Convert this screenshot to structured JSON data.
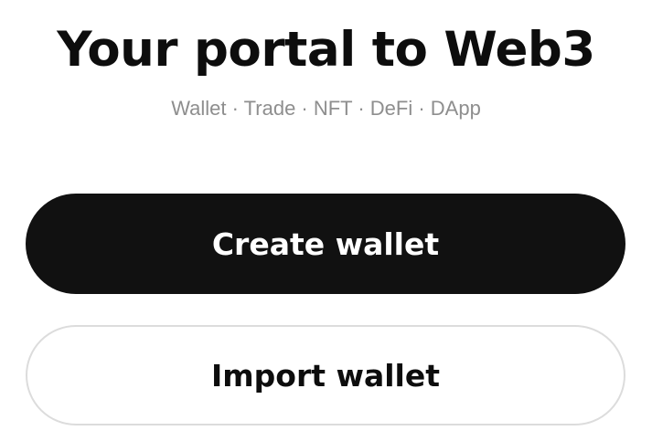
{
  "header": {
    "title": "Your portal to Web3",
    "tagline": "Wallet · Trade · NFT · DeFi · DApp"
  },
  "actions": {
    "create_label": "Create wallet",
    "import_label": "Import wallet"
  },
  "colors": {
    "primary_button": "#111111",
    "primary_text": "#ffffff",
    "secondary_border": "#dcdcdc",
    "tagline": "#8e8e8e"
  }
}
